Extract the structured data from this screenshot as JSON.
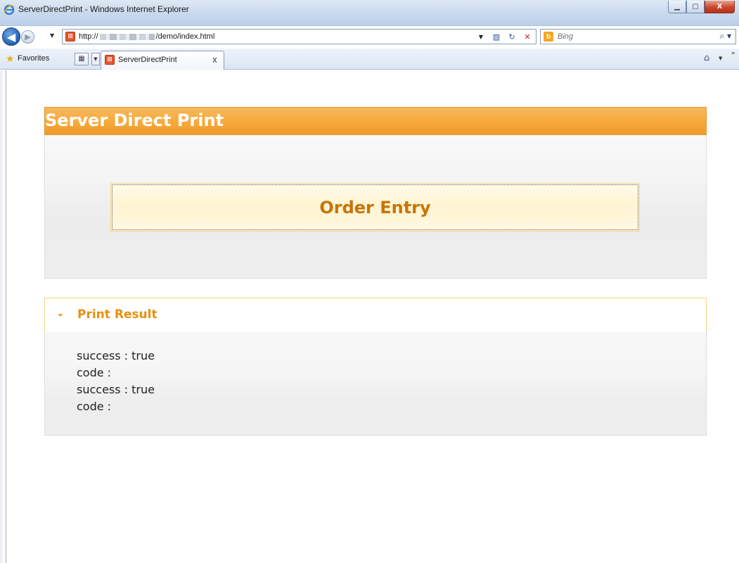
{
  "window": {
    "title": "ServerDirectPrint - Windows Internet Explorer",
    "minimize_glyph": "▁",
    "maximize_glyph": "▢",
    "close_glyph": "X"
  },
  "nav": {
    "back_glyph": "◀",
    "forward_glyph": "▶",
    "dropdown_glyph": "▼",
    "url_prefix": "http://",
    "url_suffix": "/demo/index.html",
    "search_placeholder": "Bing",
    "icons": [
      "compatibility-view-icon",
      "refresh-icon",
      "stop-icon",
      "search-icon"
    ]
  },
  "favorites": {
    "label": "Favorites",
    "tab_label": "ServerDirectPrint",
    "tab_close": "x"
  },
  "page": {
    "header_title": "Server Direct Print",
    "order_button_label": "Order Entry",
    "result_title": "Print Result",
    "result_lines": [
      "success : true",
      "code :",
      "success : true",
      "code :"
    ]
  },
  "colors": {
    "header_orange": "#f6a93a",
    "button_text": "#c77408",
    "result_title": "#e8900e",
    "result_border": "#f4d47e"
  }
}
